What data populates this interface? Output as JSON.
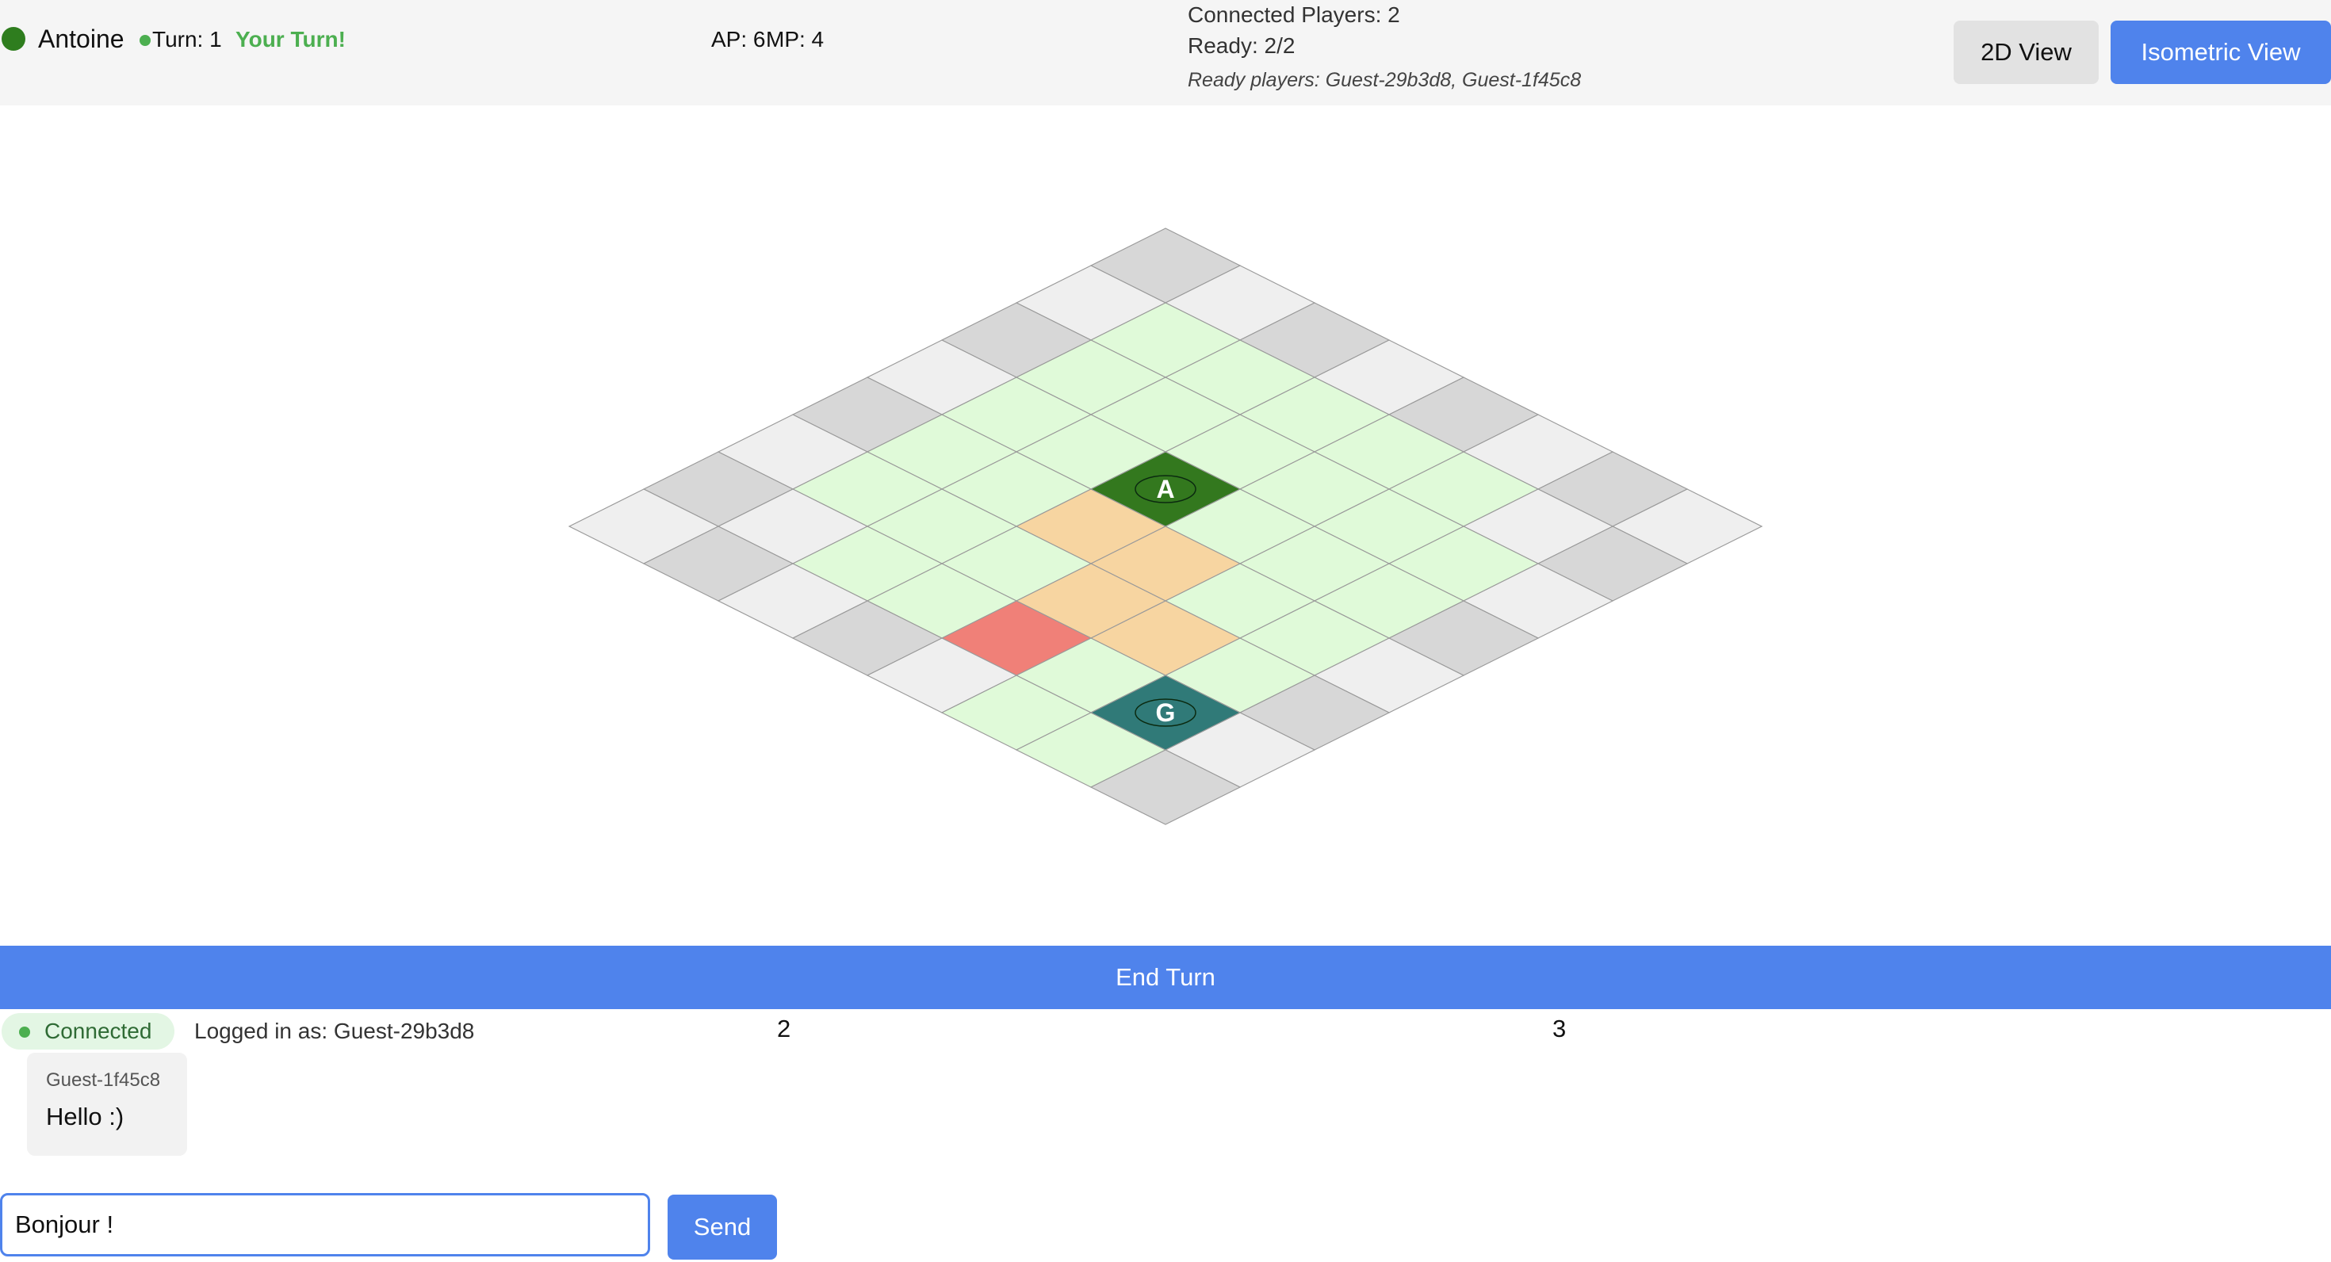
{
  "header": {
    "player_name": "Antoine",
    "player_color": "#2e7d1e",
    "turn_label": "Turn: 1",
    "your_turn_label": "Your Turn!",
    "ap_label": "AP: 6",
    "mp_label": "MP: 4",
    "connected_players": "Connected Players: 2",
    "ready_count": "Ready: 2/2",
    "ready_players": "Ready players: Guest-29b3d8, Guest-1f45c8"
  },
  "view_buttons": {
    "view_2d": "2D View",
    "view_isometric": "Isometric View",
    "active": "Isometric View"
  },
  "board": {
    "rows": 8,
    "cols": 8,
    "colors": {
      "dark": "#d7d7d7",
      "light": "#efefef",
      "reachable": "#e0fad9",
      "path": "#f7d5a1",
      "target": "#f08078",
      "player_a": "#33781e",
      "player_g": "#307a78"
    },
    "reachable_cells": [
      [
        1,
        1
      ],
      [
        1,
        2
      ],
      [
        1,
        3
      ],
      [
        1,
        4
      ],
      [
        1,
        5
      ],
      [
        2,
        1
      ],
      [
        2,
        2
      ],
      [
        2,
        3
      ],
      [
        2,
        4
      ],
      [
        2,
        5
      ],
      [
        2,
        6
      ],
      [
        3,
        1
      ],
      [
        3,
        2
      ],
      [
        3,
        3
      ],
      [
        3,
        4
      ],
      [
        3,
        5
      ],
      [
        3,
        6
      ],
      [
        4,
        1
      ],
      [
        4,
        2
      ],
      [
        4,
        3
      ],
      [
        4,
        4
      ],
      [
        4,
        5
      ],
      [
        4,
        6
      ],
      [
        5,
        1
      ],
      [
        5,
        2
      ],
      [
        5,
        3
      ],
      [
        5,
        4
      ],
      [
        5,
        5
      ],
      [
        5,
        6
      ],
      [
        6,
        2
      ],
      [
        6,
        3
      ],
      [
        6,
        4
      ],
      [
        6,
        5
      ],
      [
        6,
        6
      ],
      [
        7,
        5
      ],
      [
        7,
        6
      ]
    ],
    "path_cells": [
      [
        4,
        3
      ],
      [
        4,
        4
      ],
      [
        5,
        4
      ],
      [
        5,
        5
      ]
    ],
    "target_cells": [
      [
        6,
        4
      ]
    ],
    "units": [
      {
        "label": "A",
        "row": 3,
        "col": 3,
        "color_key": "player_a"
      },
      {
        "label": "G",
        "row": 6,
        "col": 6,
        "color_key": "player_g"
      }
    ]
  },
  "end_turn_label": "End Turn",
  "status": {
    "connection": "Connected",
    "logged_in": "Logged in as: Guest-29b3d8",
    "number_2": "2",
    "number_3": "3"
  },
  "chat": {
    "messages": [
      {
        "author": "Guest-1f45c8",
        "text": "Hello :)"
      }
    ],
    "input_value": "Bonjour !",
    "send_label": "Send"
  }
}
